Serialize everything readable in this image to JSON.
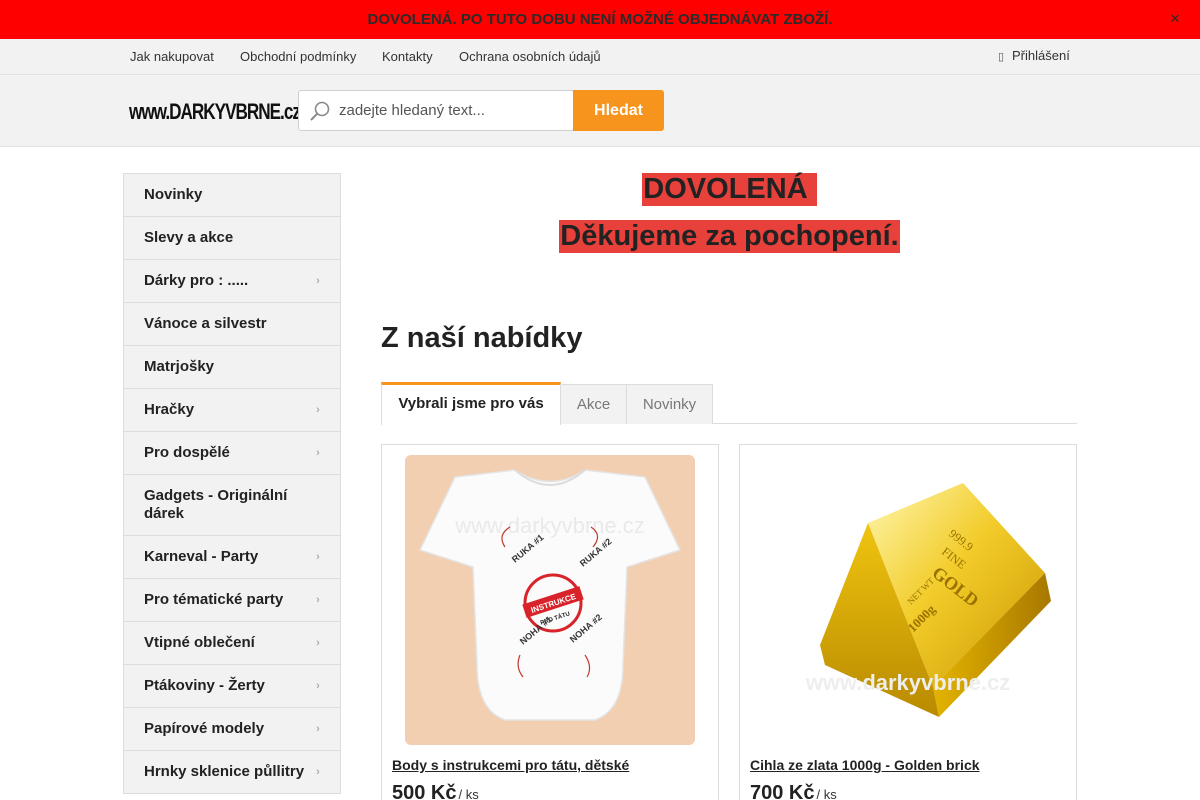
{
  "banner": {
    "text": "DOVOLENÁ. PO TUTO DOBU NENÍ MOŽNÉ OBJEDNÁVAT ZBOŽÍ.",
    "close_icon": "close-icon"
  },
  "topnav": {
    "links": [
      "Jak nakupovat",
      "Obchodní podmínky",
      "Kontakty",
      "Ochrana osobních údajů"
    ],
    "login_label": "Přihlášení"
  },
  "header": {
    "logo_text": "www.DARKYVBRNE.cz",
    "search_placeholder": "zadejte hledaný text...",
    "search_button": "Hledat"
  },
  "sidebar": {
    "items": [
      {
        "label": "Novinky",
        "has_children": false
      },
      {
        "label": "Slevy a akce",
        "has_children": false
      },
      {
        "label": "Dárky pro : .....",
        "has_children": true
      },
      {
        "label": "Vánoce a silvestr",
        "has_children": false
      },
      {
        "label": "Matrjošky",
        "has_children": false
      },
      {
        "label": "Hračky",
        "has_children": true
      },
      {
        "label": "Pro dospělé",
        "has_children": true
      },
      {
        "label": "Gadgets - Originální dárek",
        "has_children": false
      },
      {
        "label": "Karneval - Party",
        "has_children": true
      },
      {
        "label": "Pro tématické party",
        "has_children": true
      },
      {
        "label": "Vtipné oblečení",
        "has_children": true
      },
      {
        "label": "Ptákoviny - Žerty",
        "has_children": true
      },
      {
        "label": "Papírové modely",
        "has_children": true
      },
      {
        "label": "Hrnky sklenice půllitry",
        "has_children": true
      }
    ]
  },
  "notice": {
    "line1": "DOVOLENÁ ",
    "line2": "Děkujeme za pochopení."
  },
  "offer": {
    "title": "Z naší nabídky",
    "tabs": [
      "Vybrali jsme pro vás",
      "Akce",
      "Novinky"
    ],
    "active_tab": 0
  },
  "products": [
    {
      "name": "Body s instrukcemi pro tátu, dětské",
      "price": "500 Kč",
      "unit": "/ ks",
      "image_watermark": "www.darkyvbrne.cz",
      "image_texts": [
        "INSTRUKCE",
        "PRO TÁTU",
        "RUKA #1",
        "RUKA #2",
        "NOHA #1",
        "NOHA #2"
      ]
    },
    {
      "name": "Cihla ze zlata 1000g - Golden brick",
      "price": "700 Kč",
      "unit": "/ ks",
      "image_watermark": "www.darkyvbrne.cz",
      "image_texts": [
        "999.9",
        "FINE",
        "GOLD",
        "NET WT",
        "1000g"
      ]
    }
  ],
  "colors": {
    "banner_red": "#ff0000",
    "notice_red": "#e8403a",
    "accent_orange": "#f7941d",
    "panel_gray": "#f2f2f2"
  }
}
